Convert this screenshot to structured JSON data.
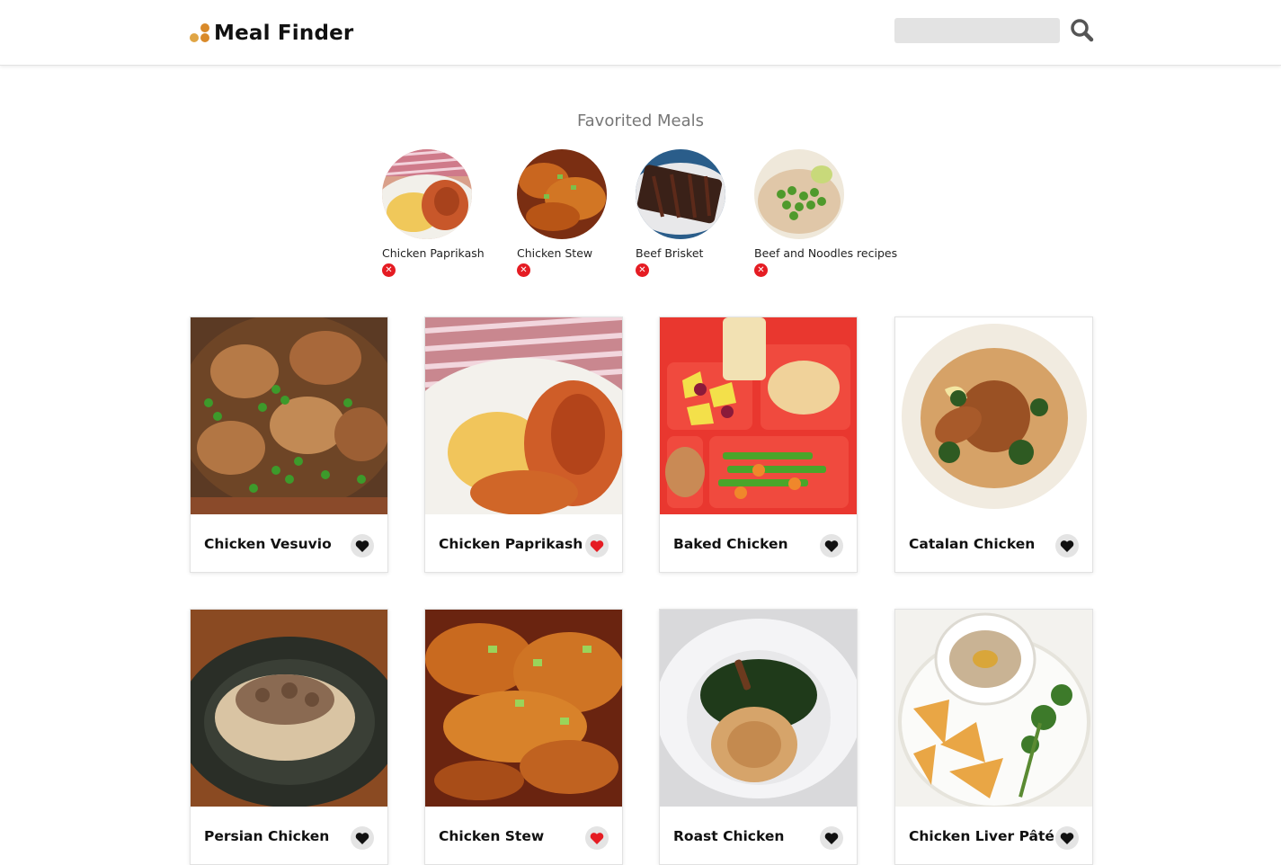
{
  "header": {
    "brand": "Meal Finder",
    "search": {
      "value": "",
      "placeholder": ""
    }
  },
  "favorites": {
    "title": "Favorited Meals",
    "items": [
      {
        "name": "Chicken Paprikash"
      },
      {
        "name": "Chicken Stew"
      },
      {
        "name": "Beef Brisket"
      },
      {
        "name": "Beef and Noodles recipes"
      }
    ]
  },
  "meals": [
    {
      "name": "Chicken Vesuvio",
      "favorited": false
    },
    {
      "name": "Chicken Paprikash",
      "favorited": true
    },
    {
      "name": "Baked Chicken",
      "favorited": false
    },
    {
      "name": "Catalan Chicken",
      "favorited": false
    },
    {
      "name": "Persian Chicken",
      "favorited": false
    },
    {
      "name": "Chicken Stew",
      "favorited": true
    },
    {
      "name": "Roast Chicken",
      "favorited": false
    },
    {
      "name": "Chicken Liver Pâté",
      "favorited": false
    }
  ],
  "colors": {
    "favorited_heart": "#e51c23",
    "default_heart": "#111111",
    "remove_badge": "#e51c23",
    "brand_dots": "#e0a545"
  },
  "icons": {
    "search": "search-icon",
    "heart": "heart-icon",
    "remove": "close-icon"
  }
}
